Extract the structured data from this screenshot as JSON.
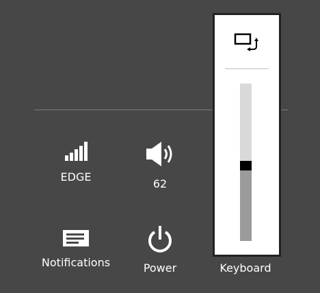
{
  "tiles": {
    "network": {
      "label": "EDGE",
      "icon": "signal-bars-icon"
    },
    "volume": {
      "label": "62",
      "icon": "speaker-icon"
    },
    "notifications": {
      "label": "Notifications",
      "icon": "message-icon"
    },
    "power": {
      "label": "Power",
      "icon": "power-icon"
    },
    "keyboard": {
      "label": "Keyboard"
    }
  },
  "flyout": {
    "icon": "rotation-lock-icon",
    "brightness_level": 0.48
  },
  "colors": {
    "background": "#474747",
    "text": "#ffffff",
    "flyout_bg": "#ffffff",
    "slider_track": "#d9d9d9",
    "slider_fill": "#9b9b9b",
    "slider_thumb": "#000000"
  }
}
